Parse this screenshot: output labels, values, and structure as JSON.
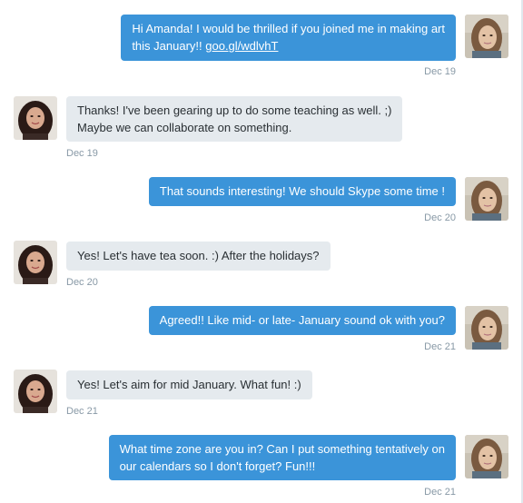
{
  "messages": [
    {
      "direction": "sent",
      "lines": [
        "Hi Amanda! I would be thrilled if you joined me in making art",
        "this January!! "
      ],
      "link": "goo.gl/wdlvhT",
      "time": "Dec 19"
    },
    {
      "direction": "received",
      "lines": [
        "Thanks! I've been gearing up to do some teaching as well. ;)",
        "Maybe we can collaborate on something."
      ],
      "time": "Dec 19"
    },
    {
      "direction": "sent",
      "lines": [
        "That sounds interesting! We should Skype some time !"
      ],
      "time": "Dec 20"
    },
    {
      "direction": "received",
      "lines": [
        "Yes! Let's have tea soon. :) After the holidays?"
      ],
      "time": "Dec 20"
    },
    {
      "direction": "sent",
      "lines": [
        "Agreed!! Like mid- or late- January sound ok with you?"
      ],
      "time": "Dec 21"
    },
    {
      "direction": "received",
      "lines": [
        "Yes! Let's aim for mid January. What fun! :)"
      ],
      "time": "Dec 21"
    },
    {
      "direction": "sent",
      "lines": [
        "What time zone are you in? Can I put something tentatively on",
        "our calendars so I don't forget?  Fun!!!"
      ],
      "time": "Dec 21"
    }
  ],
  "icons": {
    "sender_avatar": "avatar-light-hair-woman",
    "recipient_avatar": "avatar-dark-hair-woman"
  },
  "colors": {
    "sent_bubble": "#3b94d9",
    "received_bubble": "#e5eaee",
    "timestamp": "#8899a6"
  }
}
